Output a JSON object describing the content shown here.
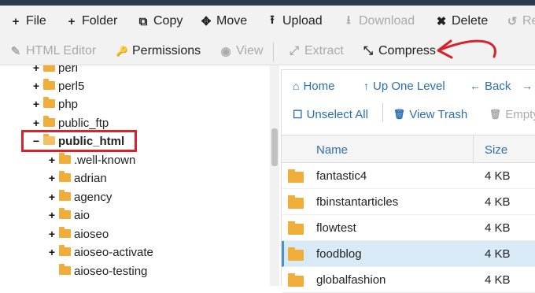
{
  "toolbar_primary": [
    {
      "label": "File",
      "icon": "plus-icon",
      "glyph": "+"
    },
    {
      "label": "Folder",
      "icon": "plus-icon",
      "glyph": "+"
    },
    {
      "label": "Copy",
      "icon": "copy-icon",
      "glyph": "⧉"
    },
    {
      "label": "Move",
      "icon": "move-icon",
      "glyph": "✥"
    },
    {
      "label": "Upload",
      "icon": "upload-icon",
      "glyph": "⭱"
    },
    {
      "label": "Download",
      "icon": "download-icon",
      "glyph": "⭳",
      "disabled": true
    },
    {
      "label": "Delete",
      "icon": "close-icon",
      "glyph": "✖"
    },
    {
      "label": "Re",
      "icon": "restore-icon",
      "glyph": "↺",
      "disabled": true
    }
  ],
  "toolbar_secondary": [
    {
      "label": "HTML Editor",
      "icon": "edit-icon",
      "glyph": "✎",
      "disabled": true
    },
    {
      "label": "Permissions",
      "icon": "key-icon",
      "glyph": "🔑"
    },
    {
      "label": "View",
      "icon": "eye-icon",
      "glyph": "◉",
      "disabled": true
    },
    {
      "label": "Extract",
      "icon": "expand-icon",
      "glyph": "⤢",
      "disabled": true
    },
    {
      "label": "Compress",
      "icon": "compress-icon",
      "glyph": "⤡"
    }
  ],
  "tree": {
    "items": [
      {
        "label": "perl",
        "toggle": "+"
      },
      {
        "label": "perl5",
        "toggle": "+"
      },
      {
        "label": "php",
        "toggle": "+"
      },
      {
        "label": "public_ftp",
        "toggle": "+"
      },
      {
        "label": "public_html",
        "toggle": "−",
        "open": true
      },
      {
        "label": ".well-known",
        "toggle": "+"
      },
      {
        "label": "adrian",
        "toggle": "+"
      },
      {
        "label": "agency",
        "toggle": "+"
      },
      {
        "label": "aio",
        "toggle": "+"
      },
      {
        "label": "aioseo",
        "toggle": "+"
      },
      {
        "label": "aioseo-activate",
        "toggle": "+"
      },
      {
        "label": "aioseo-testing",
        "toggle": ""
      }
    ]
  },
  "file_toolbar_row1": [
    {
      "label": "Home",
      "icon": "home-icon",
      "glyph": "⌂"
    },
    {
      "label": "Up One Level",
      "icon": "up-arrow-icon",
      "glyph": "↑"
    },
    {
      "label": "Back",
      "icon": "back-arrow-icon",
      "glyph": "←"
    },
    {
      "label": "",
      "icon": "forward-icon",
      "glyph": "→"
    }
  ],
  "file_toolbar_row2": [
    {
      "label": "Unselect All",
      "icon": "checkbox-icon",
      "glyph": "☐"
    },
    {
      "label": "View Trash",
      "icon": "trash-icon",
      "glyph": "🗑"
    },
    {
      "label": "Empty",
      "icon": "trash-icon",
      "glyph": "🗑",
      "disabled": true
    }
  ],
  "file_table": {
    "headers": {
      "name": "Name",
      "size": "Size"
    },
    "rows": [
      {
        "name": "fantastic4",
        "size": "4 KB"
      },
      {
        "name": "fbinstantarticles",
        "size": "4 KB"
      },
      {
        "name": "flowtest",
        "size": "4 KB"
      },
      {
        "name": "foodblog",
        "size": "4 KB",
        "selected": true
      },
      {
        "name": "globalfashion",
        "size": "4 KB"
      }
    ]
  },
  "colors": {
    "accent": "#2a6fb0",
    "folder": "#f0ad3a",
    "highlight": "#d9232a",
    "selected_row": "#d9eaf7"
  }
}
